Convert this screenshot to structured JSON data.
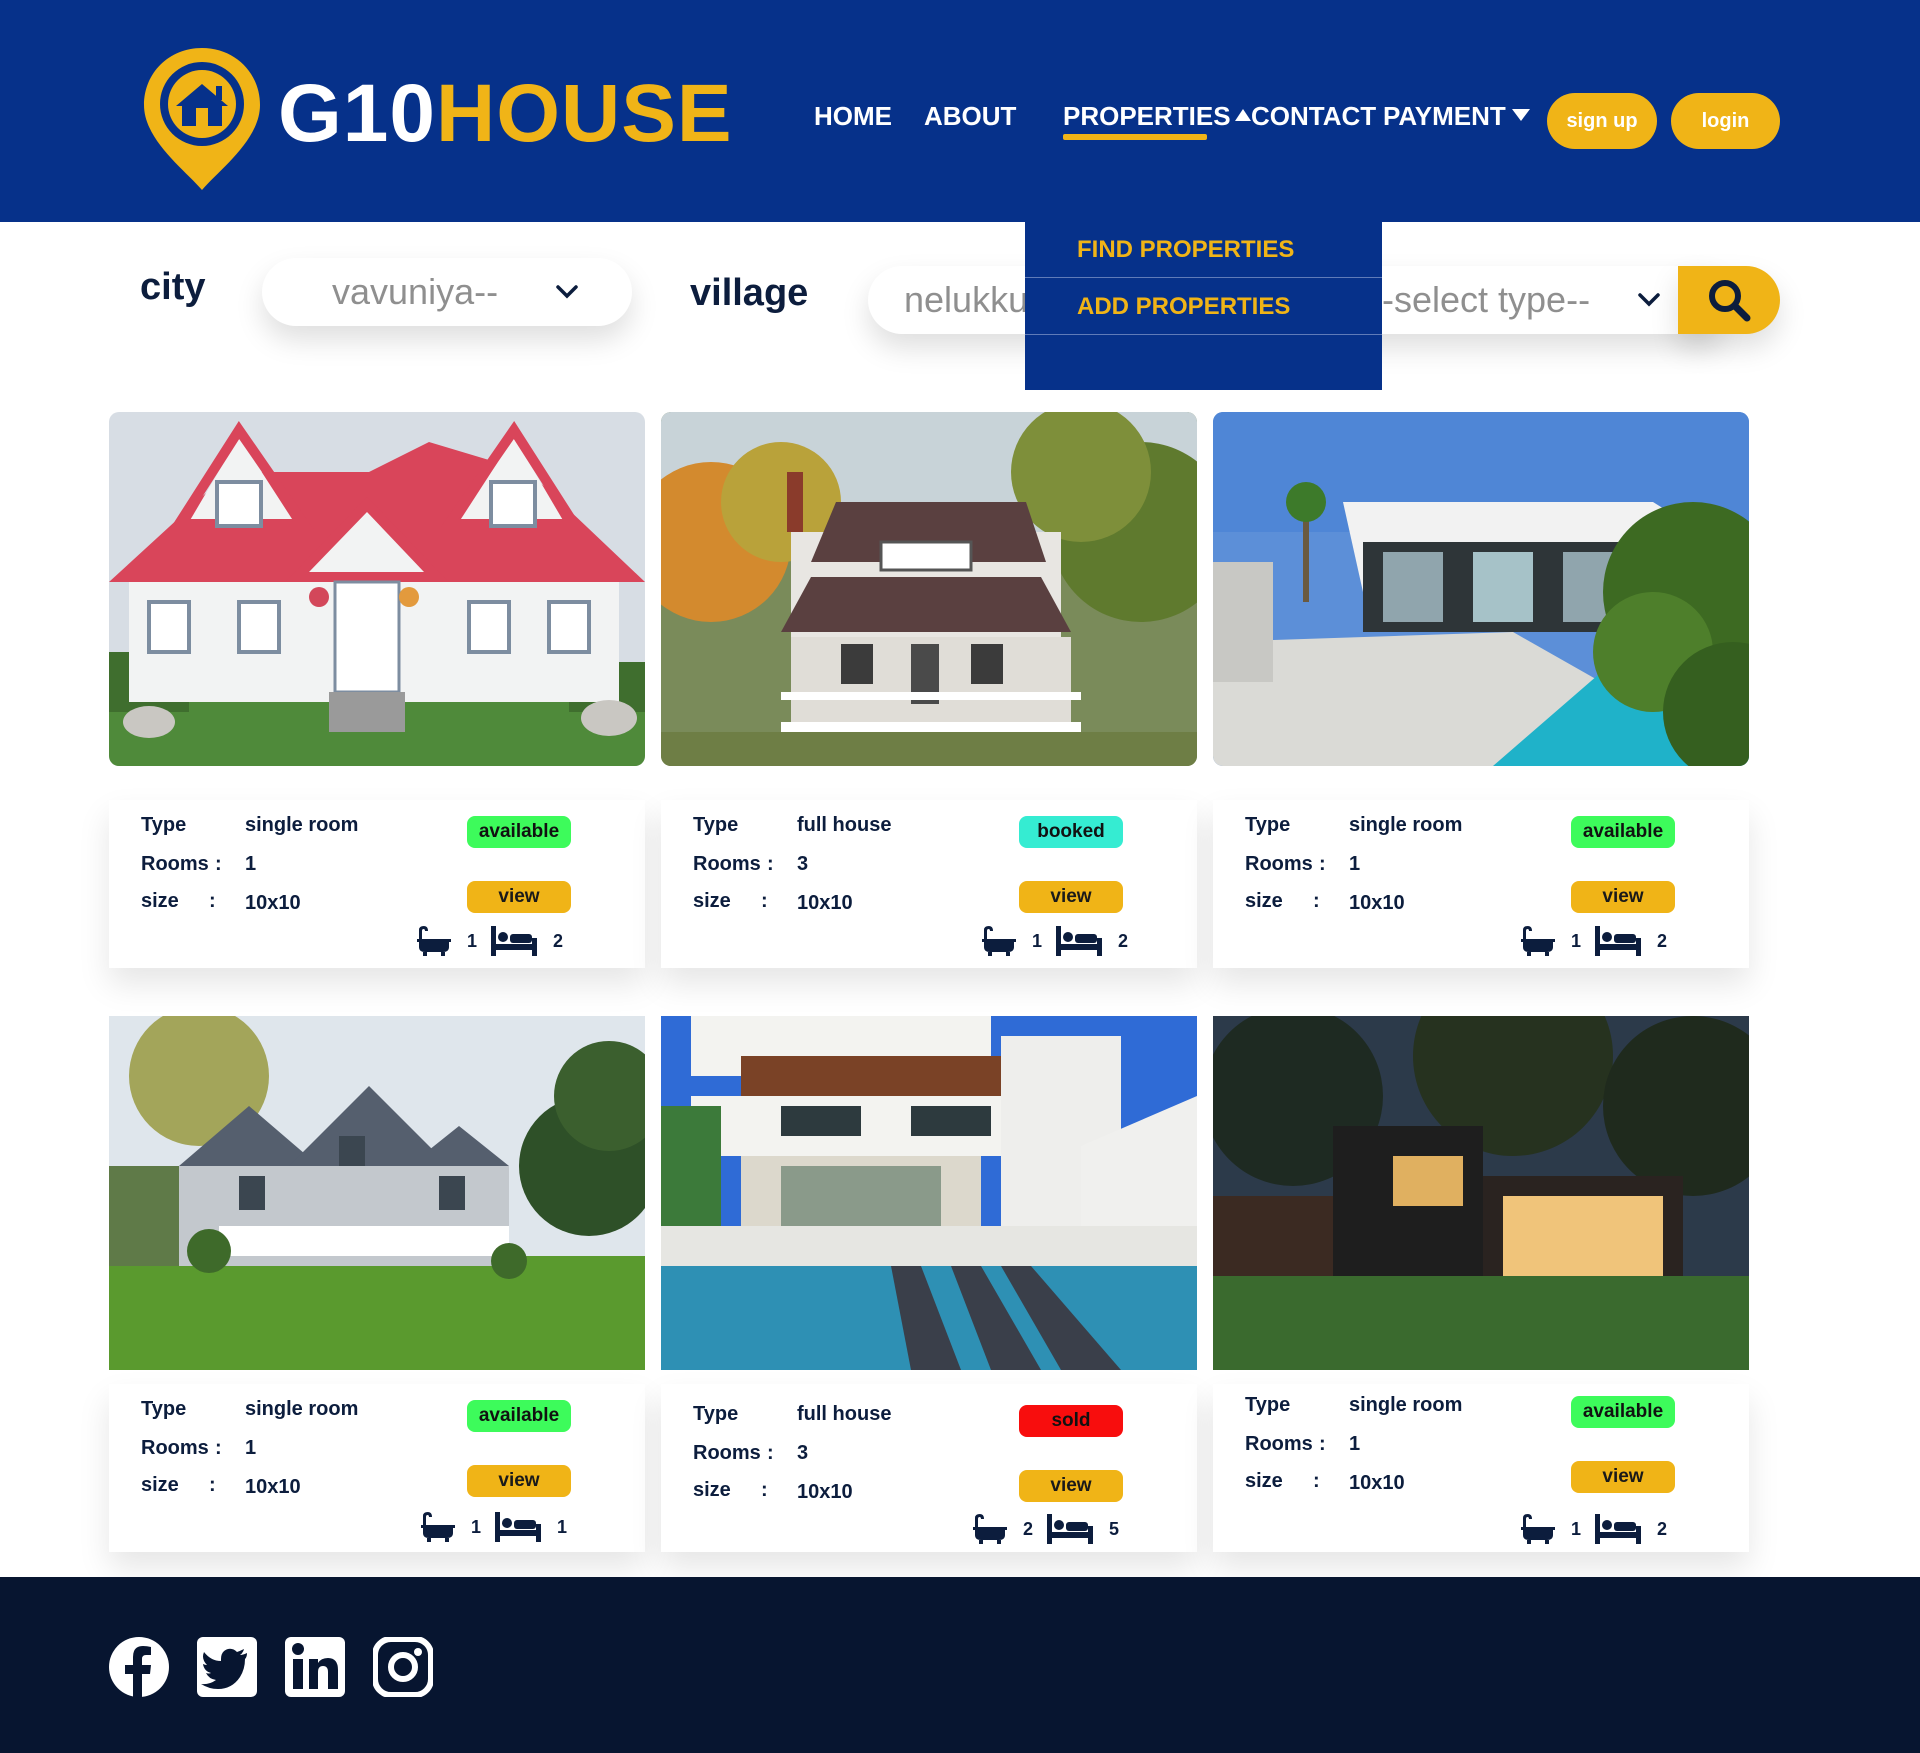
{
  "brand": {
    "part1": "G10",
    "part2": "HOUSE"
  },
  "nav": {
    "home": "HOME",
    "about": "ABOUT",
    "properties": "PROPERTIES",
    "contact": "CONTACT",
    "payment": "PAYMENT",
    "signup": "sign up",
    "login": "login"
  },
  "properties_menu": [
    "FIND PROPERTIES",
    "ADD PROPERTIES"
  ],
  "search": {
    "city_label": "city",
    "city_value": "vavuniya--",
    "village_label": "village",
    "village_value": "nelukku",
    "type_value": "-select type--"
  },
  "labels": {
    "type": "Type",
    "rooms": "Rooms",
    "size": "size",
    "colon": ":",
    "view": "view"
  },
  "listings": [
    {
      "type": "single room",
      "rooms": "1",
      "size": "10x10",
      "status": "available",
      "baths": "1",
      "beds": "2"
    },
    {
      "type": "full house",
      "rooms": "3",
      "size": "10x10",
      "status": "booked",
      "baths": "1",
      "beds": "2"
    },
    {
      "type": "single room",
      "rooms": "1",
      "size": "10x10",
      "status": "available",
      "baths": "1",
      "beds": "2"
    },
    {
      "type": "single room",
      "rooms": "1",
      "size": "10x10",
      "status": "available",
      "baths": "1",
      "beds": "1"
    },
    {
      "type": "full house",
      "rooms": "3",
      "size": "10x10",
      "status": "sold",
      "baths": "2",
      "beds": "5"
    },
    {
      "type": "single room",
      "rooms": "1",
      "size": "10x10",
      "status": "available",
      "baths": "1",
      "beds": "2"
    }
  ],
  "colors": {
    "header": "#06318a",
    "accent": "#f0b417",
    "footer": "#071530",
    "available": "#3dfb5b",
    "booked": "#35ecd2",
    "sold": "#f80d0d"
  },
  "social_icons": [
    "facebook-icon",
    "twitter-icon",
    "linkedin-icon",
    "instagram-icon"
  ]
}
